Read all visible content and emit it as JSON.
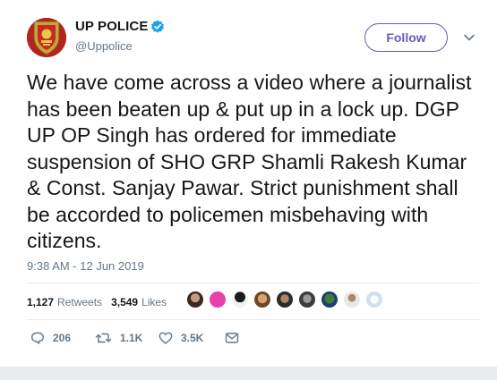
{
  "header": {
    "display_name": "UP POLICE",
    "handle": "@Uppolice",
    "follow_label": "Follow"
  },
  "tweet": {
    "text": "We have come across a video where a journalist has been beaten up & put up in a lock up. DGP UP OP Singh has ordered for immediate suspension of SHO GRP Shamli Rakesh Kumar & Const. Sanjay Pawar. Strict punishment shall be accorded to policemen misbehaving with citizens.",
    "timestamp": "9:38 AM - 12 Jun 2019"
  },
  "stats": {
    "retweets_count": "1,127",
    "retweets_label": "Retweets",
    "likes_count": "3,549",
    "likes_label": "Likes"
  },
  "actions": {
    "reply_count": "206",
    "retweet_count": "1.1K",
    "like_count": "3.5K"
  },
  "colors": {
    "accent": "#6b5bb5",
    "verified": "#1da1f2",
    "muted_text": "#657786",
    "text": "#14171a",
    "divider": "#e6ecf0"
  },
  "icons": {
    "reply": "reply-icon",
    "retweet": "retweet-icon",
    "like": "heart-icon",
    "dm": "envelope-icon",
    "verified": "verified-badge-icon",
    "more": "chevron-down-icon"
  }
}
